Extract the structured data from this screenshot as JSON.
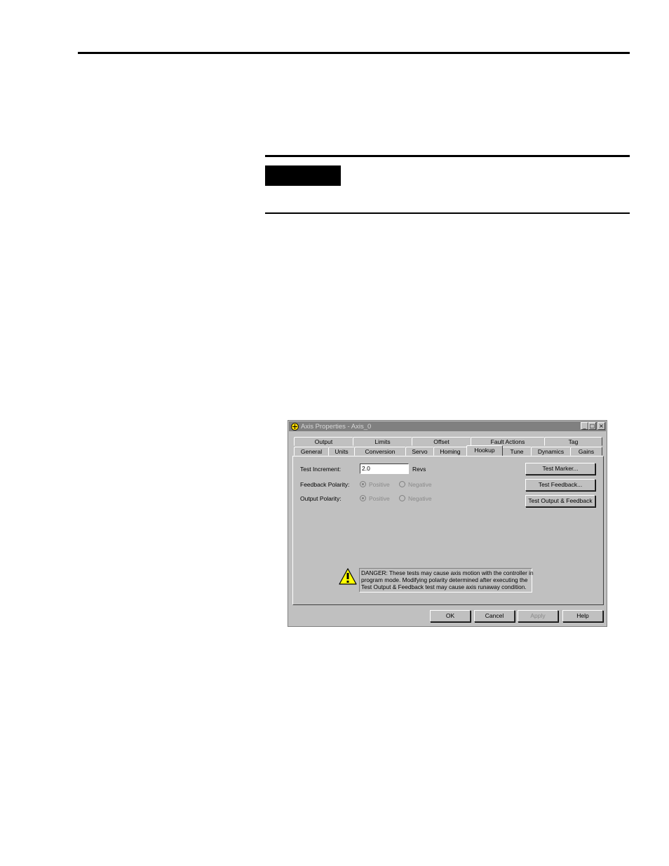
{
  "dialog": {
    "title": "Axis Properties - Axis_0",
    "title_buttons": {
      "minimize": "_",
      "maximize": "□",
      "close": "×"
    },
    "tabs_back_row": [
      "Output",
      "Limits",
      "Offset",
      "Fault Actions",
      "Tag"
    ],
    "tabs_front_row": [
      "General",
      "Units",
      "Conversion",
      "Servo",
      "Homing",
      "Hookup",
      "Tune",
      "Dynamics",
      "Gains"
    ],
    "active_tab": "Hookup",
    "fields": {
      "test_increment_label": "Test Increment:",
      "test_increment_value": "2.0",
      "test_increment_unit": "Revs",
      "feedback_polarity_label": "Feedback Polarity:",
      "output_polarity_label": "Output Polarity:",
      "positive_label": "Positive",
      "negative_label": "Negative"
    },
    "side_buttons": {
      "test_marker": "Test Marker...",
      "test_feedback": "Test Feedback...",
      "test_output_feedback": "Test Output & Feedback"
    },
    "danger_lines": [
      "DANGER: These tests may cause axis motion with the controller in",
      "program mode. Modifying polarity determined after executing the",
      "Test Output & Feedback test may cause axis runaway condition."
    ],
    "footer_buttons": {
      "ok": "OK",
      "cancel": "Cancel",
      "apply": "Apply",
      "help": "Help"
    },
    "colors": {
      "title_bar": "#808080",
      "face": "#c0c0c0",
      "warning": "#ffff00"
    }
  }
}
